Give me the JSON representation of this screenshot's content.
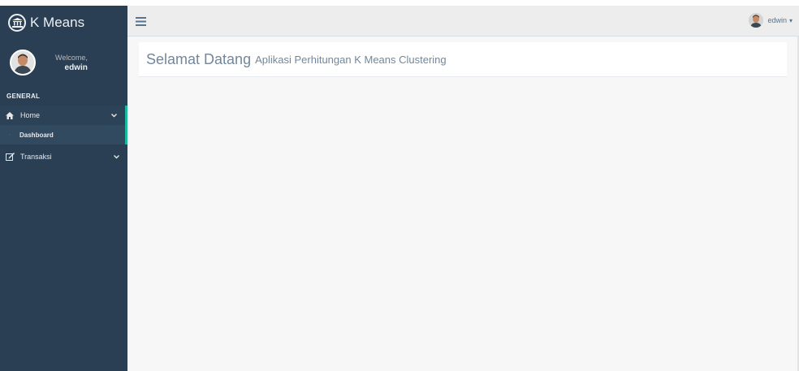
{
  "brand": {
    "title": "K Means",
    "icon": "bank-icon"
  },
  "profile": {
    "welcome": "Welcome,",
    "name": "edwin"
  },
  "sidebar": {
    "section_title": "GENERAL",
    "items": [
      {
        "label": "Home",
        "icon": "home-icon",
        "expanded": true,
        "children": [
          {
            "label": "Dashboard"
          }
        ]
      },
      {
        "label": "Transaksi",
        "icon": "edit-icon",
        "expanded": false
      }
    ]
  },
  "topnav": {
    "user": "edwin",
    "menu_icon": "hamburger-icon"
  },
  "main": {
    "title": "Selamat Datang",
    "subtitle": "Aplikasi Perhitungan K Means Clustering"
  },
  "colors": {
    "sidebar": "#2a3f54",
    "accent": "#1abb9c",
    "topnav": "#ededed",
    "content": "#f7f7f7",
    "title": "#73879c"
  }
}
